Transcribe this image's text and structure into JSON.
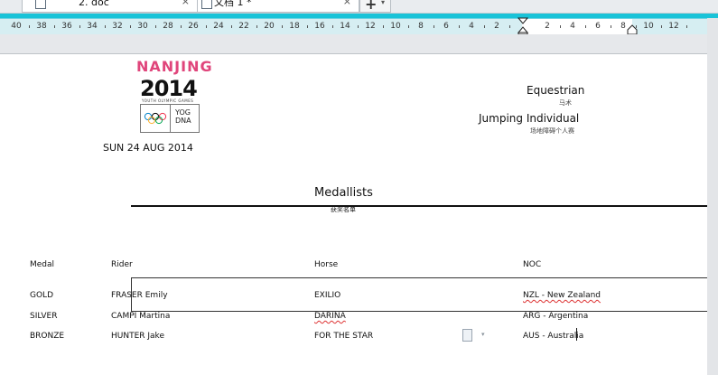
{
  "tabs": [
    {
      "label": "2. doc",
      "close": "×"
    },
    {
      "label": "文档 1 *",
      "close": "×"
    }
  ],
  "tab_new": {
    "plus": "+",
    "drop": "▾"
  },
  "ruler": {
    "numbers": [
      "40",
      "38",
      "36",
      "34",
      "32",
      "30",
      "28",
      "26",
      "24",
      "22",
      "20",
      "18",
      "16",
      "14",
      "12",
      "10",
      "8",
      "6",
      "4",
      "2",
      "2",
      "4",
      "6",
      "8",
      "10",
      "12"
    ]
  },
  "header": {
    "sport": "Equestrian",
    "sport_cn": "马术",
    "event": "Jumping Individual",
    "event_cn": "场地障碍个人赛",
    "date": "SUN  24 AUG 2014"
  },
  "logo": {
    "word": "NANJING",
    "year": "2014",
    "subtitle": "YOUTH OLYMPIC GAMES",
    "yog_line1": "YOG",
    "yog_line2": "DNA"
  },
  "section": {
    "title": "Medallists",
    "title_cn": "获奖名单"
  },
  "table": {
    "headers": [
      "Medal",
      "Rider",
      "Horse",
      "NOC"
    ],
    "rows": [
      [
        "GOLD",
        "FRASER Emily",
        "EXILIO",
        "NZL - New Zealand"
      ],
      [
        "SILVER",
        "CAMPI Martina",
        "DARINA",
        "ARG - Argentina"
      ],
      [
        "BRONZE",
        "HUNTER Jake",
        "FOR THE STAR",
        "AUS - Australia"
      ]
    ]
  },
  "colors": {
    "accent": "#19c3d8",
    "ring_blue": "#0081c8",
    "ring_yellow": "#fcb131",
    "ring_black": "#000000",
    "ring_green": "#00a651",
    "ring_red": "#ee334e"
  },
  "icons": {
    "paste_options": "paste-options-icon"
  }
}
